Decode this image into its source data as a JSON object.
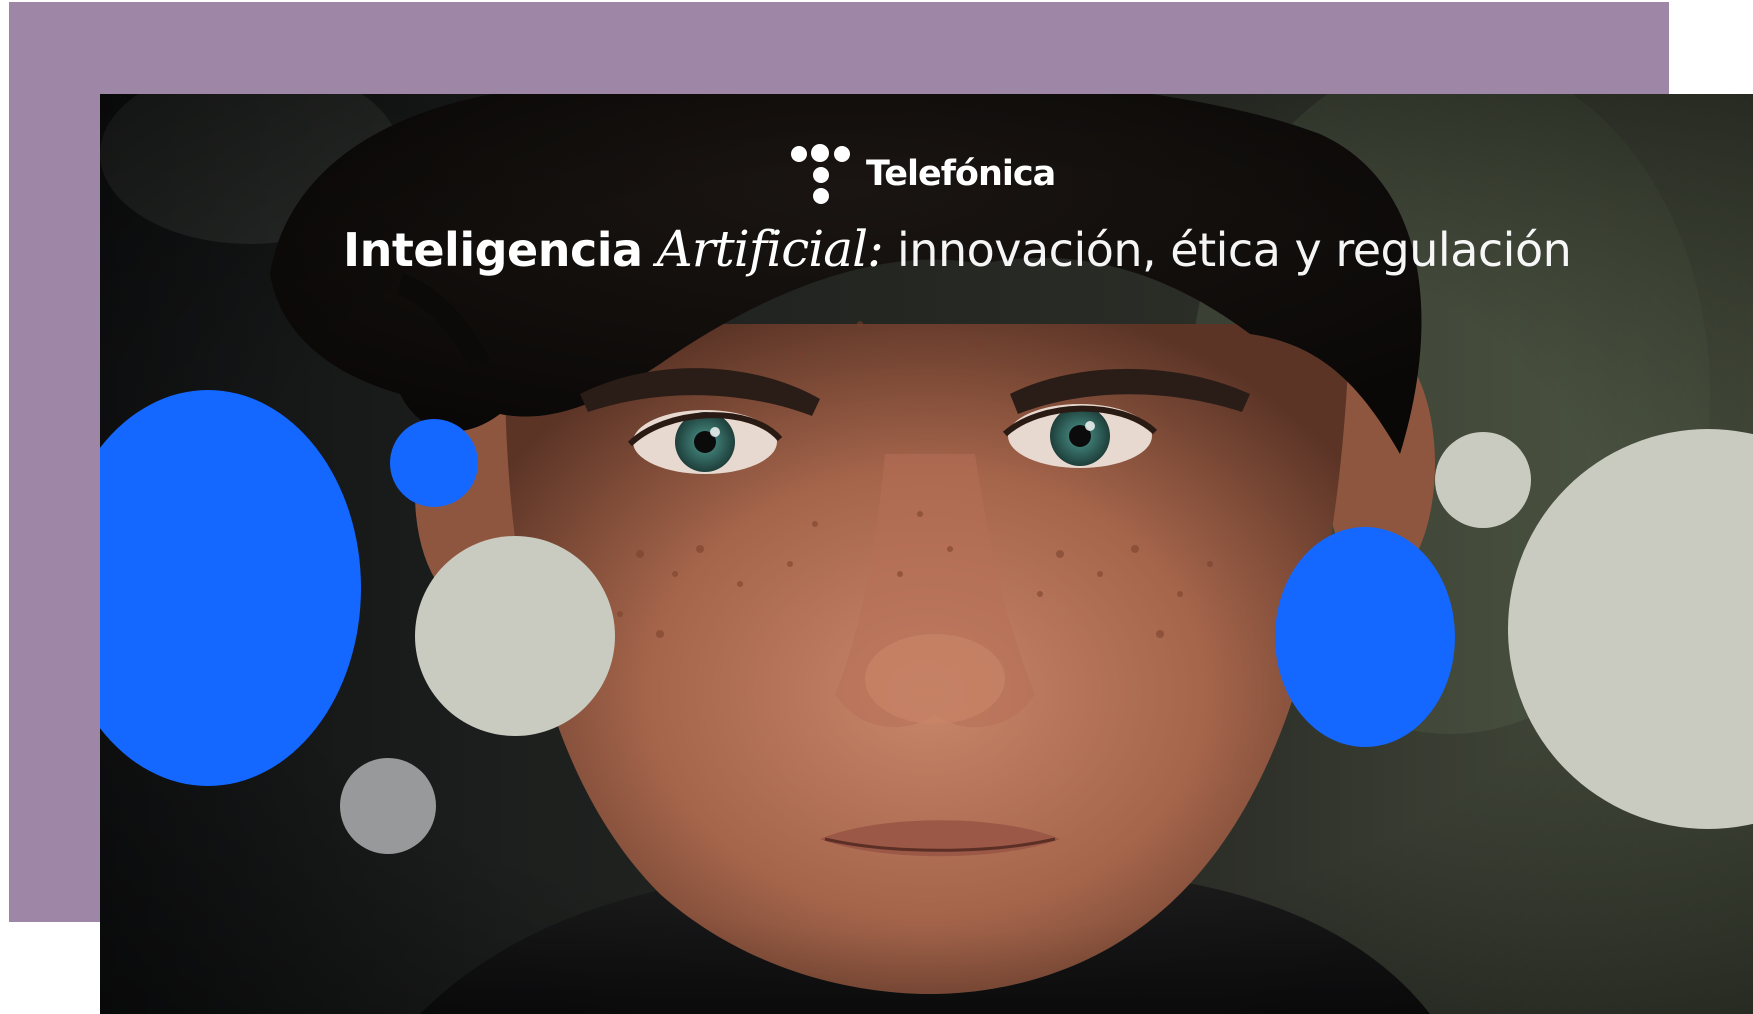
{
  "brand": {
    "name": "Telefónica",
    "logo_icon": "telefonica-dots-t-icon"
  },
  "headline": {
    "part1": "Inteligencia",
    "part2": "Artificial:",
    "part3": "innovación, ética y regulación"
  },
  "colors": {
    "back_panel": "#9e86a6",
    "circle_blue": "#1468ff",
    "circle_light": "#c9cbc1",
    "circle_grey": "#97999b"
  }
}
